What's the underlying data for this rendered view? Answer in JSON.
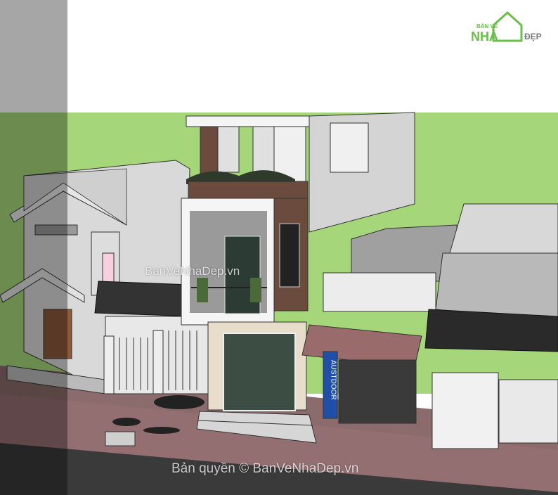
{
  "logo": {
    "line1": "BẢN VẼ",
    "line2": "NHÀ",
    "line3": "ĐẸP"
  },
  "watermark_mid": "BanVeNhaDep.vn",
  "watermark_bottom": "Bản quyền © BanVeNhaDep.vn",
  "sign_text": "AUSTDOOR",
  "colors": {
    "sky": "#ffffff",
    "grass": "#a6d67a",
    "sidewalk": "#8a6a6a",
    "road": "#3e3e3e",
    "facade_white": "#f2f2f2",
    "facade_brown": "#6b4b3e",
    "tile_beige": "#e8dccb",
    "logo_green": "#6abf4b",
    "logo_gray": "#7a7a7a"
  }
}
